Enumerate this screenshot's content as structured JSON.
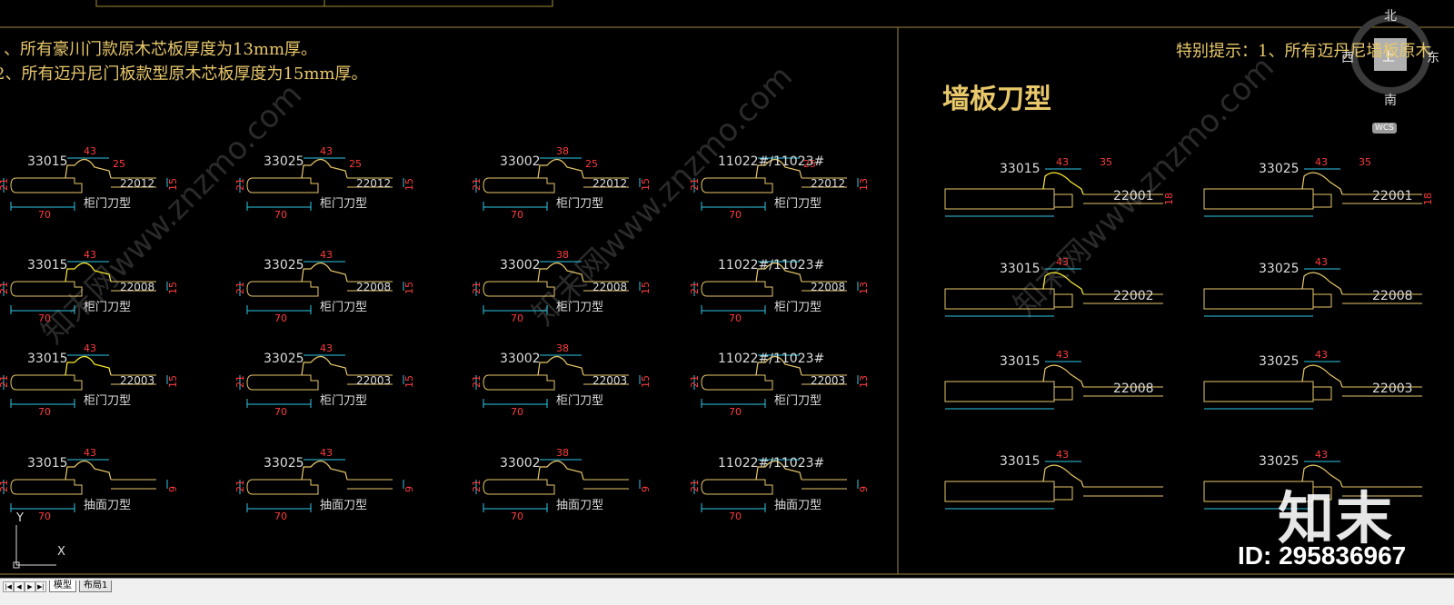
{
  "notes_left": {
    "line1": "、所有豪川门款原木芯板厚度为13mm厚。",
    "line2": "2、所有迈丹尼门板款型原木芯板厚度为15mm厚。"
  },
  "notes_right": {
    "line1": "特别提示：1、所有迈丹尼墙板原木"
  },
  "wall_title": "墙板刀型",
  "compass": {
    "north": "北",
    "south": "南",
    "west": "西",
    "east": "东",
    "wcs": "WCS"
  },
  "watermark": "知末网www.znzmo.com",
  "brand": {
    "logo": "知末",
    "id": "ID: 295836967"
  },
  "tabs": {
    "model": "模型",
    "layout1": "布局1"
  },
  "nav_buttons": [
    "|◀",
    "◀",
    "▶",
    "▶|"
  ],
  "ucs": {
    "x": "X",
    "y": "Y"
  },
  "colors": {
    "outline": "#e8c86a",
    "dim": "#2ec8e8",
    "dimtext": "#ff3b3b",
    "yellow": "#ffee30",
    "frame": "#a08a3a"
  },
  "drawing": {
    "left_grid": [
      {
        "code": "33015",
        "a": "43",
        "b": "25",
        "h": "21",
        "w": "70",
        "suffix": "22012",
        "t": "15",
        "label": "柜门刀型"
      },
      {
        "code": "33025",
        "a": "43",
        "b": "25",
        "h": "21",
        "w": "70",
        "suffix": "22012",
        "t": "15",
        "label": "柜门刀型"
      },
      {
        "code": "33002",
        "a": "38",
        "b": "25",
        "h": "21",
        "w": "70",
        "suffix": "22012",
        "t": "15",
        "label": "柜门刀型"
      },
      {
        "code": "11022#/11023#",
        "a": "",
        "b": "25",
        "h": "21",
        "w": "70",
        "suffix": "22012",
        "t": "13",
        "label": "柜门刀型"
      },
      {
        "code": "33015",
        "a": "43",
        "b": "",
        "h": "21",
        "w": "70",
        "suffix": "22008",
        "t": "15",
        "label": "柜门刀型"
      },
      {
        "code": "33025",
        "a": "43",
        "b": "",
        "h": "21",
        "w": "70",
        "suffix": "22008",
        "t": "15",
        "label": "柜门刀型"
      },
      {
        "code": "33002",
        "a": "38",
        "b": "",
        "h": "21",
        "w": "70",
        "suffix": "22008",
        "t": "15",
        "label": "柜门刀型"
      },
      {
        "code": "11022#/11023#",
        "a": "",
        "b": "",
        "h": "21",
        "w": "70",
        "suffix": "22008",
        "t": "13",
        "label": "柜门刀型"
      },
      {
        "code": "33015",
        "a": "43",
        "b": "",
        "h": "21",
        "w": "70",
        "suffix": "22003",
        "t": "15",
        "label": "柜门刀型"
      },
      {
        "code": "33025",
        "a": "43",
        "b": "",
        "h": "21",
        "w": "70",
        "suffix": "22003",
        "t": "15",
        "label": "柜门刀型"
      },
      {
        "code": "33002",
        "a": "38",
        "b": "",
        "h": "21",
        "w": "70",
        "suffix": "22003",
        "t": "15",
        "label": "柜门刀型"
      },
      {
        "code": "11022#/11023#",
        "a": "",
        "b": "",
        "h": "21",
        "w": "70",
        "suffix": "22003",
        "t": "13",
        "label": "柜门刀型"
      },
      {
        "code": "33015",
        "a": "43",
        "b": "",
        "h": "21",
        "w": "70",
        "suffix": "",
        "t": "9",
        "label": "抽面刀型"
      },
      {
        "code": "33025",
        "a": "43",
        "b": "",
        "h": "21",
        "w": "70",
        "suffix": "",
        "t": "9",
        "label": "抽面刀型"
      },
      {
        "code": "33002",
        "a": "38",
        "b": "",
        "h": "21",
        "w": "70",
        "suffix": "",
        "t": "9",
        "label": "抽面刀型"
      },
      {
        "code": "11022#/11023#",
        "a": "",
        "b": "",
        "h": "21",
        "w": "70",
        "suffix": "",
        "t": "9",
        "label": "抽面刀型"
      }
    ],
    "right_grid": [
      {
        "code": "33015",
        "a": "43",
        "b": "35",
        "suffix": "22001",
        "t": "18"
      },
      {
        "code": "33025",
        "a": "43",
        "b": "35",
        "suffix": "22001",
        "t": "18"
      },
      {
        "code": "33015",
        "a": "43",
        "b": "",
        "suffix": "22002",
        "t": ""
      },
      {
        "code": "33025",
        "a": "43",
        "b": "",
        "suffix": "22008",
        "t": ""
      },
      {
        "code": "33015",
        "a": "43",
        "b": "",
        "suffix": "22008",
        "t": ""
      },
      {
        "code": "33025",
        "a": "43",
        "b": "",
        "suffix": "22003",
        "t": ""
      },
      {
        "code": "33015",
        "a": "43",
        "b": "",
        "suffix": "",
        "t": ""
      },
      {
        "code": "33025",
        "a": "43",
        "b": "",
        "suffix": "",
        "t": ""
      }
    ]
  }
}
